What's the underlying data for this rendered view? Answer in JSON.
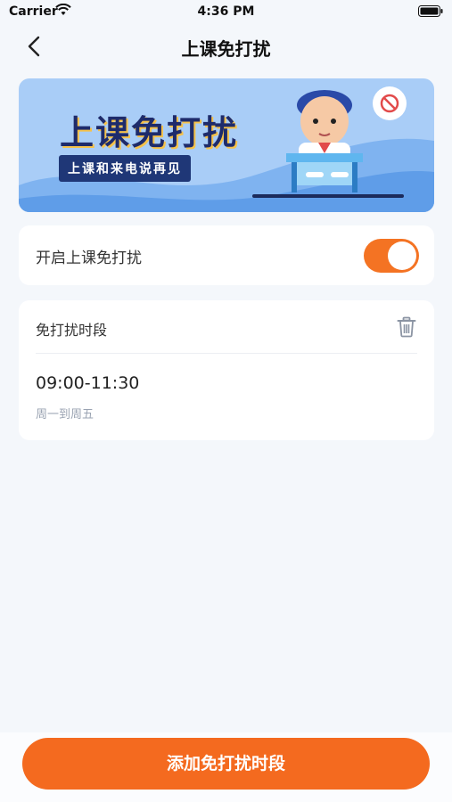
{
  "status_bar": {
    "carrier": "Carrier",
    "time": "4:36 PM"
  },
  "nav": {
    "title": "上课免打扰"
  },
  "banner": {
    "title": "上课免打扰",
    "subtitle": "上课和来电说再见"
  },
  "toggle": {
    "label": "开启上课免打扰",
    "enabled": true
  },
  "period_section": {
    "header": "免打扰时段",
    "items": [
      {
        "time": "09:00-11:30",
        "days": "周一到周五"
      }
    ]
  },
  "add_button": {
    "label": "添加免打扰时段"
  },
  "colors": {
    "accent": "#f46a1f",
    "background": "#f4f7fb",
    "banner": "#a9cdf7"
  }
}
